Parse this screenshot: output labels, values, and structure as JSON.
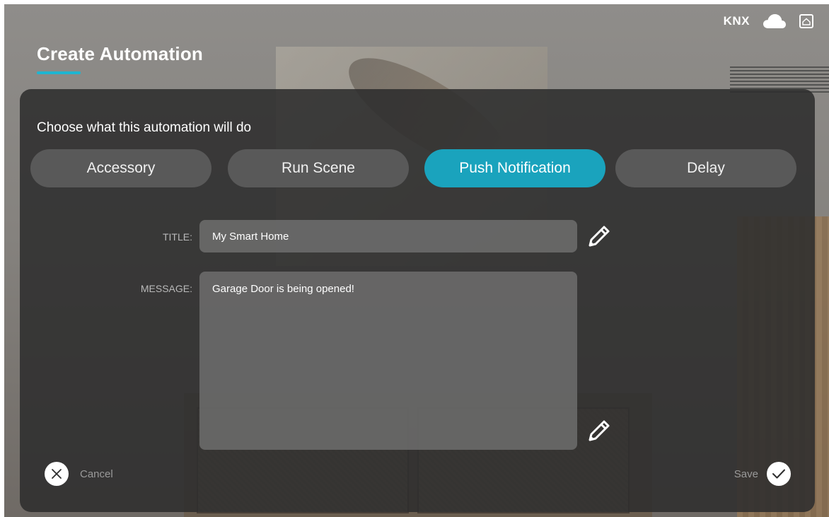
{
  "header": {
    "title": "Create Automation",
    "status_label": "KNX",
    "icons": [
      "cloud-icon",
      "home-icon"
    ]
  },
  "panel": {
    "prompt": "Choose what this automation will do",
    "tabs": [
      {
        "label": "Accessory",
        "active": false
      },
      {
        "label": "Run Scene",
        "active": false
      },
      {
        "label": "Push Notification",
        "active": true
      },
      {
        "label": "Delay",
        "active": false
      }
    ],
    "fields": {
      "title_label": "TITLE:",
      "title_value": "My Smart Home",
      "message_label": "MESSAGE:",
      "message_value": "Garage Door is being opened!"
    },
    "actions": {
      "cancel_label": "Cancel",
      "save_label": "Save"
    }
  },
  "colors": {
    "accent": "#1aa3bd",
    "underline": "#1fb5d1"
  }
}
